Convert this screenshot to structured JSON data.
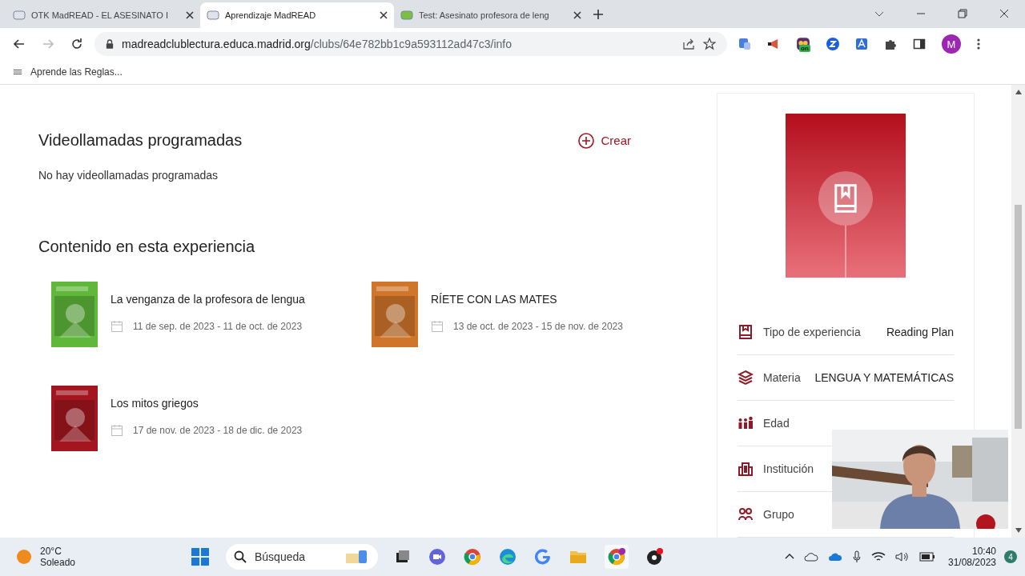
{
  "tabs": [
    {
      "title": "OTK MadREAD - EL ASESINATO I",
      "selected": false
    },
    {
      "title": "Aprendizaje MadREAD",
      "selected": true
    },
    {
      "title": "Test: Asesinato profesora de leng",
      "selected": false
    }
  ],
  "address_bar": {
    "host": "madreadclublectura.educa.madrid.org",
    "path": "/clubs/64e782bb1c9a593112ad47c3/info"
  },
  "extension_badge": "on",
  "profile_initial": "M",
  "bookmarks": [
    "Aprende las Reglas..."
  ],
  "videocalls": {
    "title": "Videollamadas programadas",
    "create_label": "Crear",
    "empty_message": "No hay videollamadas programadas"
  },
  "content": {
    "title": "Contenido en esta experiencia",
    "items": [
      {
        "title": "La venganza de la profesora de lengua",
        "dates": "11 de sep. de 2023 - 11 de oct. de 2023"
      },
      {
        "title": "RÍETE CON LAS MATES",
        "dates": "13 de oct. de 2023 - 15 de nov. de 2023"
      },
      {
        "title": "Los mitos griegos",
        "dates": "17 de nov. de 2023 - 18 de dic. de 2023"
      }
    ]
  },
  "details": [
    {
      "kind": "book",
      "label": "Tipo de experiencia",
      "value": "Reading Plan"
    },
    {
      "kind": "layers",
      "label": "Materia",
      "value": "LENGUA Y MATEMÁTICAS"
    },
    {
      "kind": "people",
      "label": "Edad"
    },
    {
      "kind": "building",
      "label": "Institución"
    },
    {
      "kind": "group",
      "label": "Grupo"
    }
  ],
  "taskbar": {
    "temperature": "20°C",
    "condition": "Soleado",
    "search_placeholder": "Búsqueda",
    "time": "10:40",
    "date": "31/08/2023",
    "notifications": "4"
  }
}
